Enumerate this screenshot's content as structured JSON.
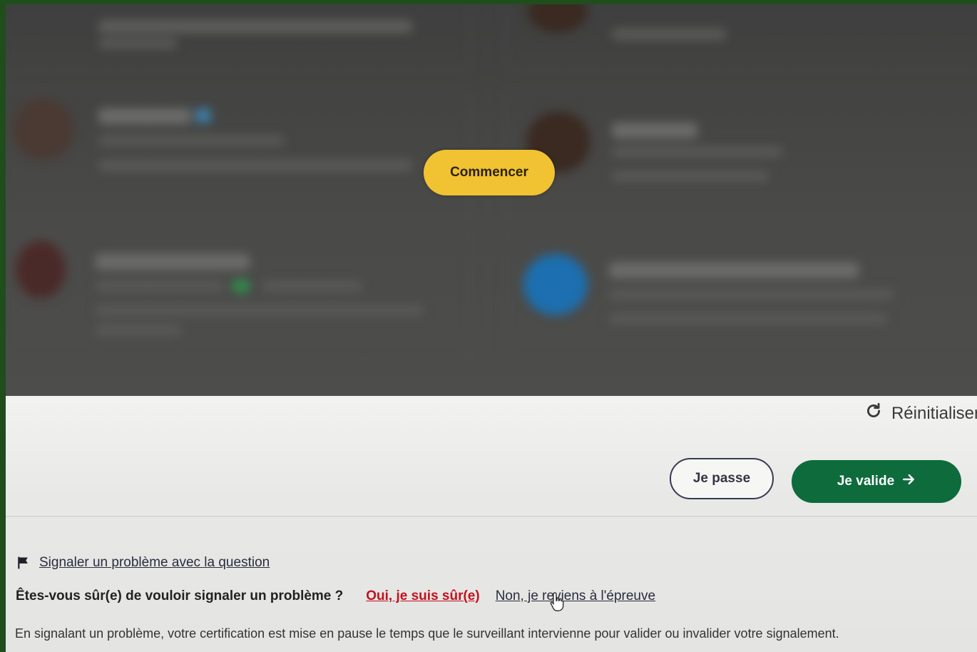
{
  "start_button": {
    "label": "Commencer",
    "color": "#f1c232"
  },
  "toolbar": {
    "reset_label": "Réinitialiser",
    "reset_icon": "refresh-icon"
  },
  "actions": {
    "skip_label": "Je passe",
    "validate_label": "Je valide",
    "validate_icon": "arrow-right-icon",
    "validate_color": "#0d6b3c"
  },
  "report": {
    "flag_icon": "flag-icon",
    "link_label": "Signaler un problème avec la question",
    "question": "Êtes-vous sûr(e) de vouloir signaler un problème ?",
    "confirm_label": "Oui, je suis sûr(e)",
    "confirm_color": "#c1121f",
    "cancel_label": "Non, je reviens à l'épreuve",
    "info": "En signalant un problème, votre certification est mise en pause le temps que le surveillant intervienne pour valider ou invalider votre signalement."
  }
}
